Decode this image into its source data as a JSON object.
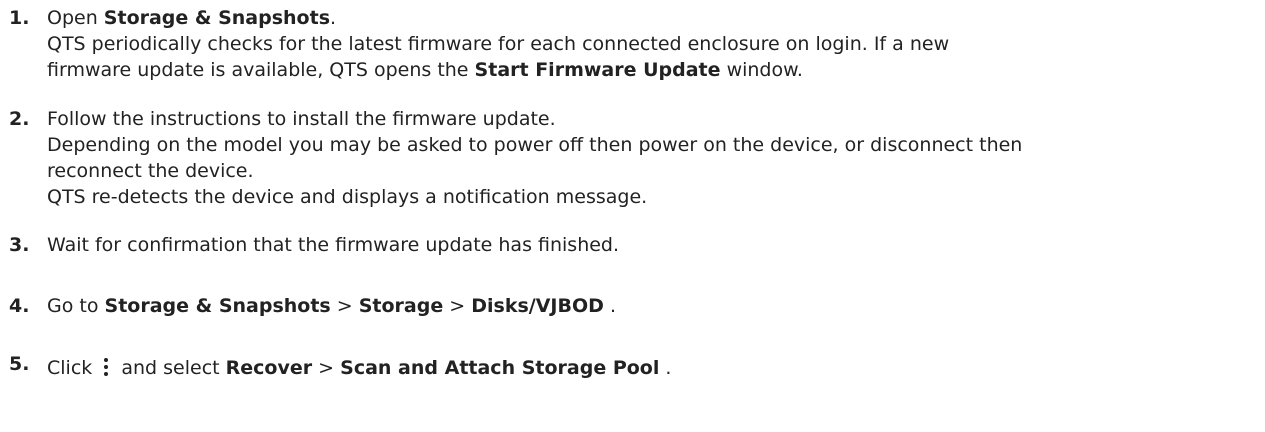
{
  "steps": [
    {
      "number": "1.",
      "line1": {
        "pre": "Open ",
        "bold": "Storage & Snapshots",
        "post": "."
      },
      "line2": "QTS periodically checks for the latest firmware for each connected enclosure on login. If a new",
      "line3": {
        "pre": "firmware update is available, QTS opens the ",
        "bold": "Start Firmware Update",
        "post": " window."
      }
    },
    {
      "number": "2.",
      "line1": "Follow the instructions to install the firmware update.",
      "line2": "Depending on the model you may be asked to power off then power on the device, or disconnect then",
      "line3": "reconnect the device.",
      "line4": "QTS re-detects the device and displays a notification message."
    },
    {
      "number": "3.",
      "line1": "Wait for confirmation that the firmware update has finished."
    },
    {
      "number": "4.",
      "pre": "Go to ",
      "bold1": "Storage & Snapshots",
      "sep1": " > ",
      "bold2": "Storage",
      "sep2": " > ",
      "bold3": "Disks/VJBOD",
      "post": " ."
    },
    {
      "number": "5.",
      "pre": "Click ",
      "icon": "kebab-menu-icon",
      "mid": " and select ",
      "bold1": "Recover",
      "sep1": " > ",
      "bold2": "Scan and Attach Storage Pool",
      "post": " ."
    }
  ]
}
